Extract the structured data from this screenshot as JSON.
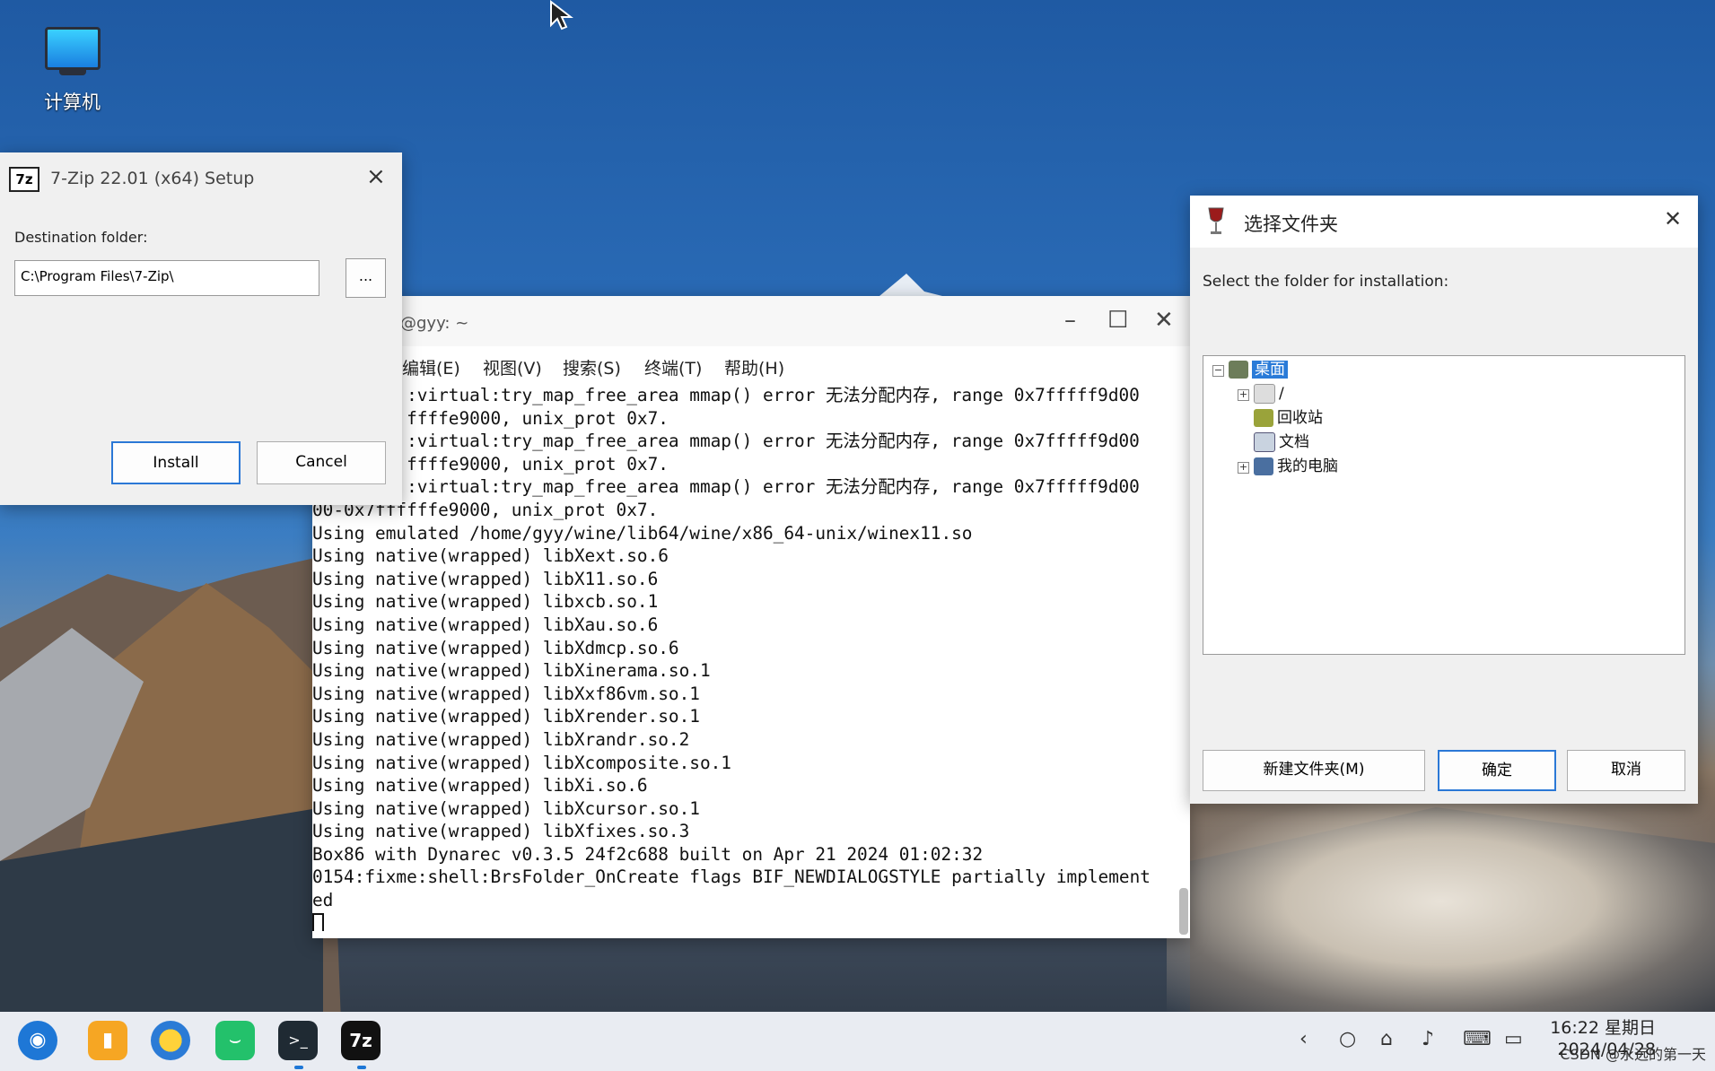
{
  "desktop": {
    "computer_label": "计算机"
  },
  "zip_window": {
    "title": "7-Zip 22.01 (x64) Setup",
    "logo": "7z",
    "close_icon": "×",
    "destination_label": "Destination folder:",
    "destination_value": "C:\\Program Files\\7-Zip\\",
    "browse_label": "...",
    "install_label": "Install",
    "cancel_label": "Cancel"
  },
  "terminal": {
    "title": "@gyy: ~",
    "menu": [
      "编辑(E)",
      "视图(V)",
      "搜索(S)",
      "终端(T)",
      "帮助(H)"
    ],
    "lines": [
      "         :virtual:try_map_free_area mmap() error 无法分配内存, range 0x7fffff9d00",
      "         ffffe9000, unix_prot 0x7.",
      "         :virtual:try_map_free_area mmap() error 无法分配内存, range 0x7fffff9d00",
      "         ffffe9000, unix_prot 0x7.",
      "         :virtual:try_map_free_area mmap() error 无法分配内存, range 0x7fffff9d00",
      "00-0x7ffffffe9000, unix_prot 0x7.",
      "Using emulated /home/gyy/wine/lib64/wine/x86_64-unix/winex11.so",
      "Using native(wrapped) libXext.so.6",
      "Using native(wrapped) libX11.so.6",
      "Using native(wrapped) libxcb.so.1",
      "Using native(wrapped) libXau.so.6",
      "Using native(wrapped) libXdmcp.so.6",
      "Using native(wrapped) libXinerama.so.1",
      "Using native(wrapped) libXxf86vm.so.1",
      "Using native(wrapped) libXrender.so.1",
      "Using native(wrapped) libXrandr.so.2",
      "Using native(wrapped) libXcomposite.so.1",
      "Using native(wrapped) libXi.so.6",
      "Using native(wrapped) libXcursor.so.1",
      "Using native(wrapped) libXfixes.so.3",
      "Box86 with Dynarec v0.3.5 24f2c688 built on Apr 21 2024 01:02:32",
      "0154:fixme:shell:BrsFolder_OnCreate flags BIF_NEWDIALOGSTYLE partially implement",
      "ed"
    ]
  },
  "folder_dialog": {
    "title": "选择文件夹",
    "prompt": "Select the folder for installation:",
    "tree": [
      {
        "label": "桌面",
        "selected": true
      },
      {
        "label": "/"
      },
      {
        "label": "回收站"
      },
      {
        "label": "文档"
      },
      {
        "label": "我的电脑"
      }
    ],
    "new_folder_label": "新建文件夹(M)",
    "ok_label": "确定",
    "cancel_label": "取消"
  },
  "taskbar": {
    "zip_label": "7z",
    "terminal_label": ">_",
    "time": "16:22 星期日",
    "date": "2024/04/28",
    "watermark": "CSDN @永远的第一天"
  }
}
